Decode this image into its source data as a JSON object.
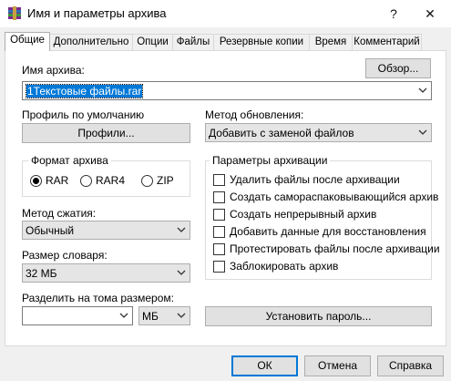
{
  "window": {
    "title": "Имя и параметры архива",
    "help_glyph": "?",
    "close_glyph": "✕",
    "icon": "winrar-icon"
  },
  "tabs": [
    {
      "label": "Общие",
      "active": true
    },
    {
      "label": "Дополнительно",
      "active": false
    },
    {
      "label": "Опции",
      "active": false
    },
    {
      "label": "Файлы",
      "active": false
    },
    {
      "label": "Резервные копии",
      "active": false
    },
    {
      "label": "Время",
      "active": false
    },
    {
      "label": "Комментарий",
      "active": false
    }
  ],
  "archive_name": {
    "label": "Имя архива:",
    "value": "1Текстовые файлы.rar",
    "browse_label": "Обзор..."
  },
  "profile": {
    "label": "Профиль по умолчанию",
    "button_label": "Профили..."
  },
  "update_method": {
    "label": "Метод обновления:",
    "value": "Добавить с заменой файлов"
  },
  "archive_format": {
    "title": "Формат архива",
    "options": [
      {
        "label": "RAR",
        "selected": true
      },
      {
        "label": "RAR4",
        "selected": false
      },
      {
        "label": "ZIP",
        "selected": false
      }
    ]
  },
  "compression": {
    "label": "Метод сжатия:",
    "value": "Обычный"
  },
  "dictionary": {
    "label": "Размер словаря:",
    "value": "32 МБ"
  },
  "split": {
    "label": "Разделить на тома размером:",
    "value": "",
    "unit": "МБ"
  },
  "archive_options": {
    "title": "Параметры архивации",
    "items": [
      {
        "label": "Удалить файлы после архивации",
        "checked": false
      },
      {
        "label": "Создать самораспаковывающийся архив",
        "checked": false
      },
      {
        "label": "Создать непрерывный архив",
        "checked": false
      },
      {
        "label": "Добавить данные для восстановления",
        "checked": false
      },
      {
        "label": "Протестировать файлы после архивации",
        "checked": false
      },
      {
        "label": "Заблокировать архив",
        "checked": false
      }
    ]
  },
  "set_password_label": "Установить пароль...",
  "footer": {
    "ok": "ОК",
    "cancel": "Отмена",
    "help": "Справка"
  },
  "colors": {
    "accent": "#0078d7",
    "selection_bg": "#0078d7"
  }
}
